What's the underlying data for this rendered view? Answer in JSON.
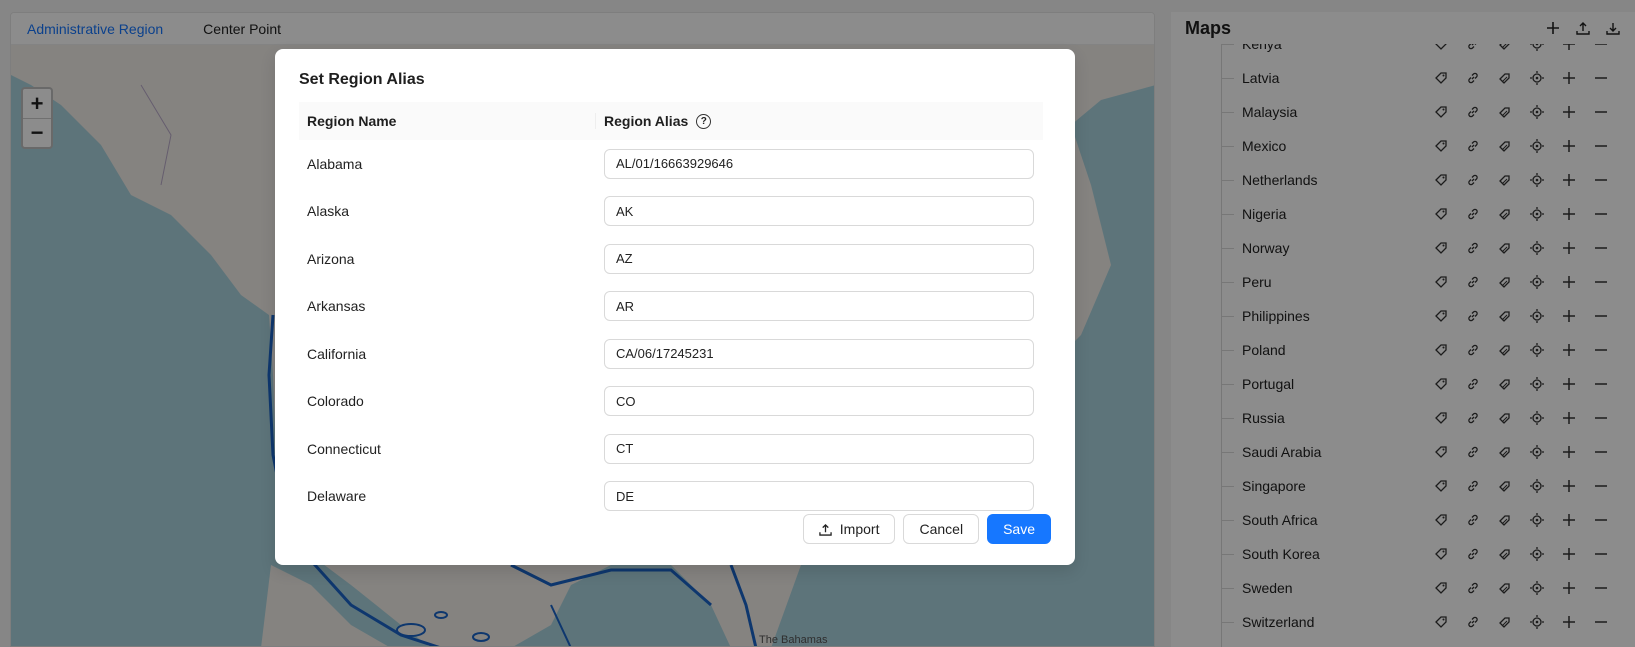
{
  "map_tabs": {
    "administrative_region": "Administrative Region",
    "center_point": "Center Point"
  },
  "zoom": {
    "in": "+",
    "out": "−"
  },
  "map_labels": {
    "bahamas": "The Bahamas"
  },
  "maps_panel": {
    "title": "Maps",
    "partial_item": "Kenya",
    "items": [
      {
        "label": "Latvia"
      },
      {
        "label": "Malaysia"
      },
      {
        "label": "Mexico"
      },
      {
        "label": "Netherlands"
      },
      {
        "label": "Nigeria"
      },
      {
        "label": "Norway"
      },
      {
        "label": "Peru"
      },
      {
        "label": "Philippines"
      },
      {
        "label": "Poland"
      },
      {
        "label": "Portugal"
      },
      {
        "label": "Russia"
      },
      {
        "label": "Saudi Arabia"
      },
      {
        "label": "Singapore"
      },
      {
        "label": "South Africa"
      },
      {
        "label": "South Korea"
      },
      {
        "label": "Sweden"
      },
      {
        "label": "Switzerland"
      }
    ],
    "row_actions": [
      "tag-icon",
      "link-icon",
      "tags-icon",
      "locate-icon",
      "add-icon",
      "remove-icon"
    ]
  },
  "modal": {
    "title": "Set Region Alias",
    "col_region_name": "Region Name",
    "col_region_alias": "Region Alias",
    "help_glyph": "?",
    "rows": [
      {
        "name": "Alabama",
        "alias": "AL/01/16663929646"
      },
      {
        "name": "Alaska",
        "alias": "AK"
      },
      {
        "name": "Arizona",
        "alias": "AZ"
      },
      {
        "name": "Arkansas",
        "alias": "AR"
      },
      {
        "name": "California",
        "alias": "CA/06/17245231"
      },
      {
        "name": "Colorado",
        "alias": "CO"
      },
      {
        "name": "Connecticut",
        "alias": "CT"
      },
      {
        "name": "Delaware",
        "alias": "DE"
      }
    ],
    "import_label": "Import",
    "cancel_label": "Cancel",
    "save_label": "Save"
  },
  "colors": {
    "accent": "#1677ff",
    "water": "#aad3df",
    "land": "#f2efe9",
    "state_border": "#1a64c8"
  }
}
